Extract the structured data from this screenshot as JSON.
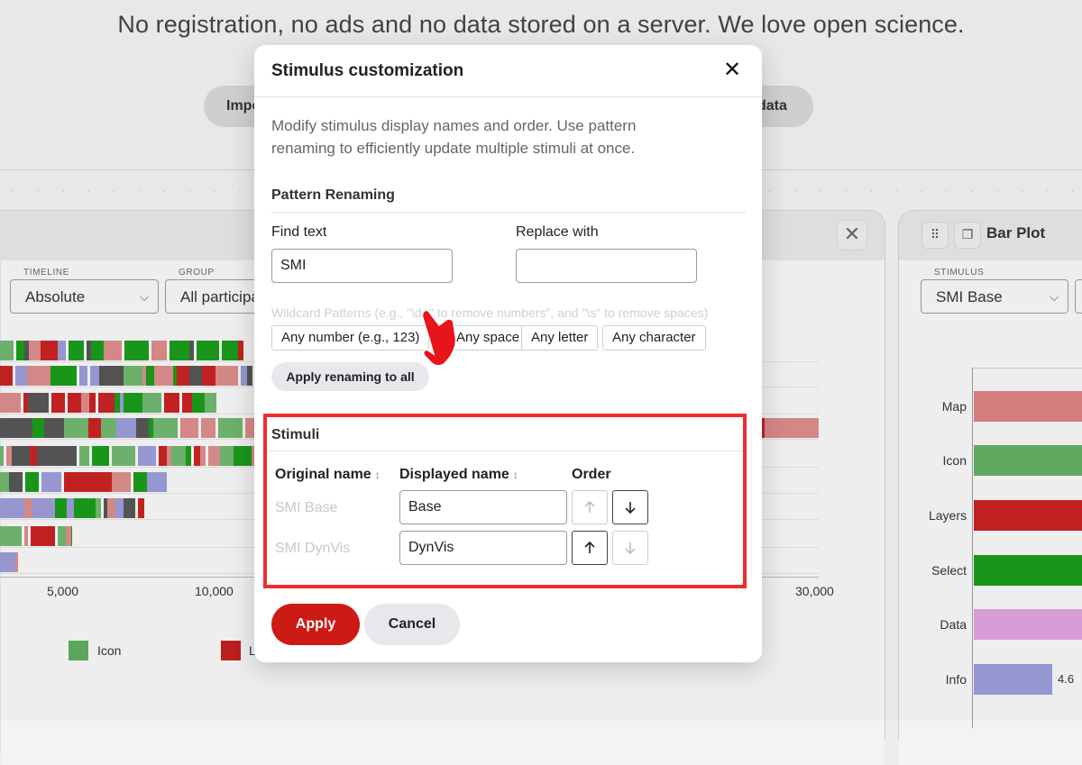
{
  "background": {
    "tagline": "No registration, no ads and no data stored on a server. We love open science.",
    "import_button": "Impo",
    "data_button": "data",
    "left_panel": {
      "timeline_label": "TIMELINE",
      "timeline_value": "Absolute",
      "group_label": "GROUP",
      "group_value": "All participa",
      "x_ticks": [
        "5,000",
        "10,000",
        "30,000"
      ],
      "legend": [
        {
          "label": "Icon",
          "color": "#5faa5f"
        },
        {
          "label": "L",
          "color": "#c11f1f"
        }
      ],
      "colors": {
        "red": "#c42323",
        "pink": "#d98a8a",
        "green": "#1a9a1a",
        "lightgreen": "#6fb46f",
        "blue": "#9a9ad6"
      }
    },
    "right_panel": {
      "title": "Bar Plot",
      "drag_icon": "drag-handle-icon",
      "copy_icon": "copy-icon",
      "stimulus_label": "STIMULUS",
      "stimulus_value": "SMI Base",
      "bars": [
        {
          "label": "Map",
          "color": "#d98080"
        },
        {
          "label": "Icon",
          "color": "#62ab62"
        },
        {
          "label": "Layers",
          "color": "#c42323"
        },
        {
          "label": "Select",
          "color": "#1a9a1a"
        },
        {
          "label": "Data",
          "color": "#dda0dd"
        },
        {
          "label": "Info",
          "color": "#9a9ad6",
          "value": "4.6"
        }
      ]
    }
  },
  "modal": {
    "title": "Stimulus customization",
    "close_icon": "close-icon",
    "description": "Modify stimulus display names and order. Use pattern renaming to efficiently update multiple stimuli at once.",
    "pattern_section": {
      "heading": "Pattern Renaming",
      "find_label": "Find text",
      "find_value": "SMI",
      "replace_label": "Replace with",
      "replace_value": "",
      "hint": "Wildcard Patterns (e.g., \"\\d+\" to remove numbers\", and \"\\s\" to remove spaces)",
      "chips": [
        "Any number (e.g., 123)",
        "Any space",
        "Any letter",
        "Any character"
      ],
      "apply_all_label": "Apply renaming to all"
    },
    "stimuli_section": {
      "heading": "Stimuli",
      "col_original": "Original name",
      "col_displayed": "Displayed name",
      "col_order": "Order",
      "rows": [
        {
          "original": "SMI Base",
          "displayed": "Base"
        },
        {
          "original": "SMI DynVis",
          "displayed": "DynVis"
        }
      ]
    },
    "apply_label": "Apply",
    "cancel_label": "Cancel",
    "accent_color": "#cc1a14",
    "highlight_color": "#ee2c2c"
  }
}
